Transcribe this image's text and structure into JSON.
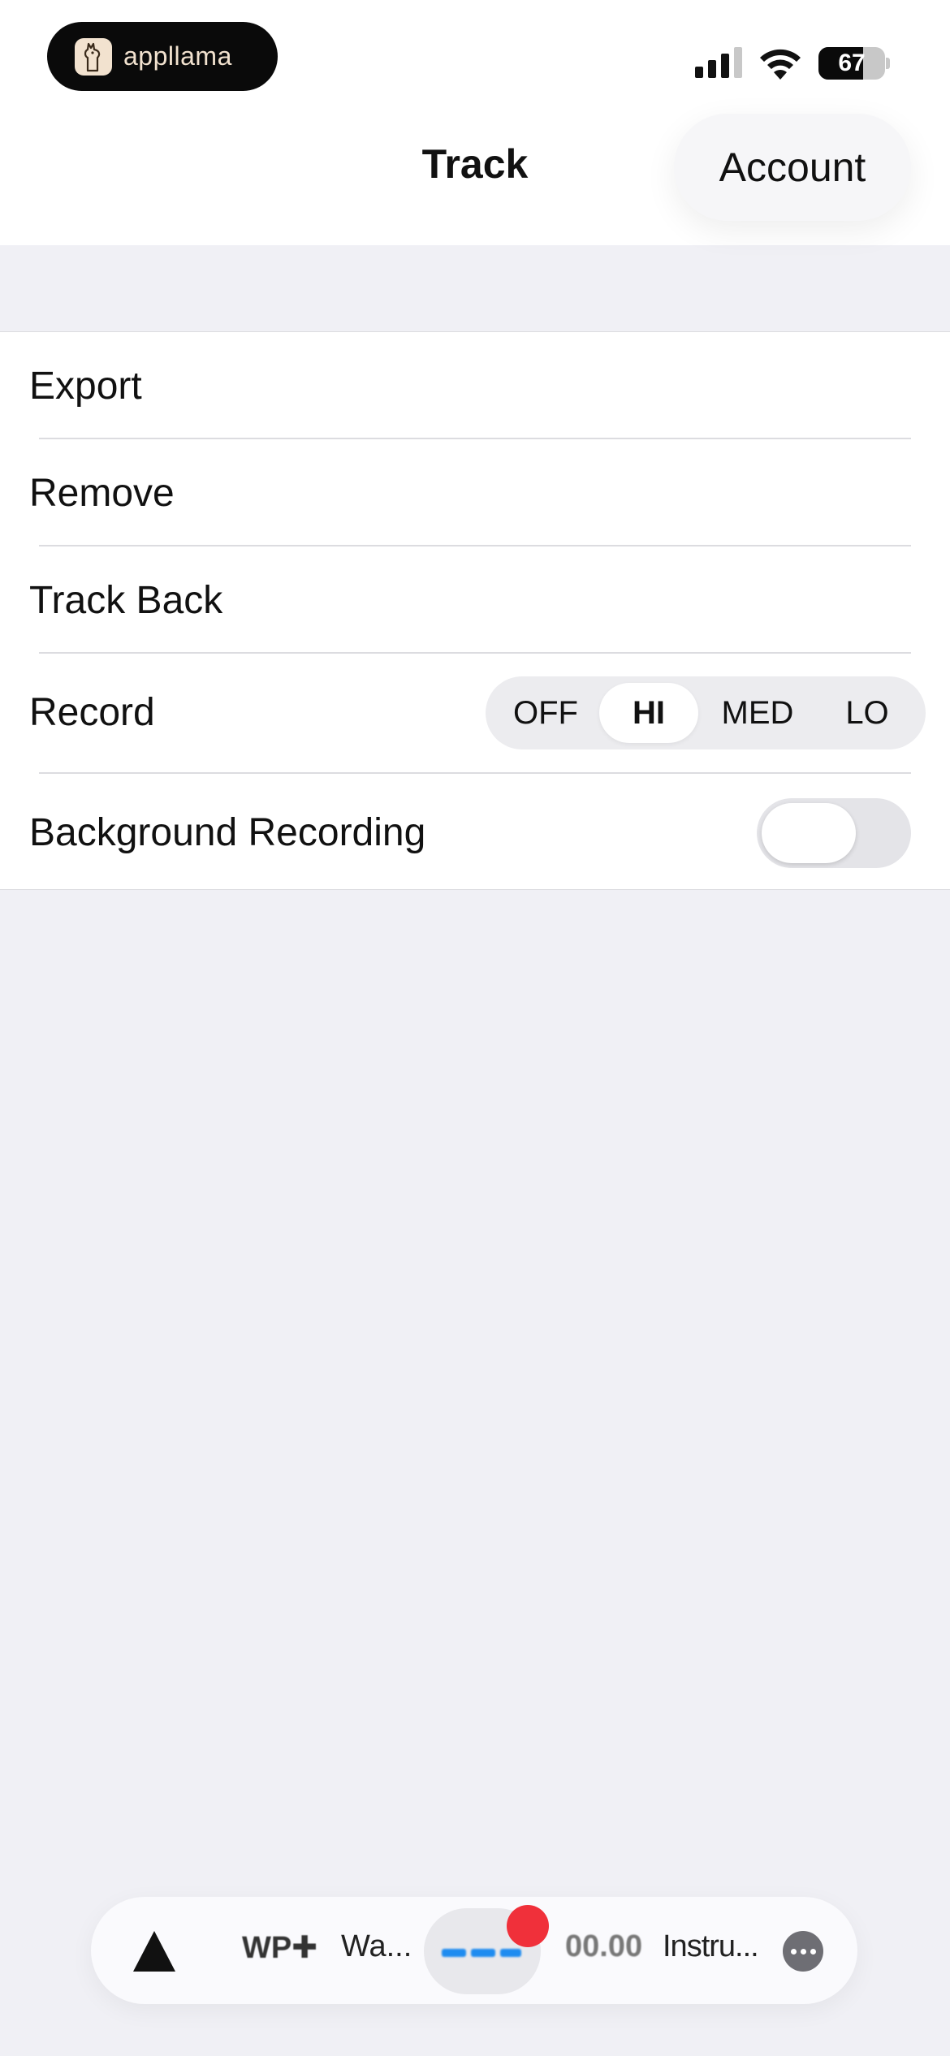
{
  "status_bar": {
    "app_badge": "appllama",
    "battery_level": "67",
    "battery_fraction": 0.67,
    "icons": [
      "llama-logo-icon",
      "signal-icon",
      "wifi-icon",
      "battery-icon"
    ]
  },
  "nav": {
    "title": "Track",
    "account_label": "Account"
  },
  "settings": {
    "export_label": "Export",
    "remove_label": "Remove",
    "track_back_label": "Track Back",
    "record_label": "Record",
    "record_options": [
      "OFF",
      "HI",
      "MED",
      "LO"
    ],
    "record_selected": "HI",
    "background_recording_label": "Background Recording",
    "background_recording_on": false
  },
  "player": {
    "brand": "WP✚",
    "track": "Wa...",
    "time": "00.00",
    "instrument": "Instru...",
    "icons": [
      "triangle-icon",
      "waveform-icon",
      "record-dot-icon",
      "more-icon"
    ]
  },
  "colors": {
    "background": "#f0f0f5",
    "accent_blue": "#1e8cf0",
    "record_red": "#f0303a",
    "app_pill": "#0a0a0a",
    "app_text": "#f2e2cf"
  }
}
